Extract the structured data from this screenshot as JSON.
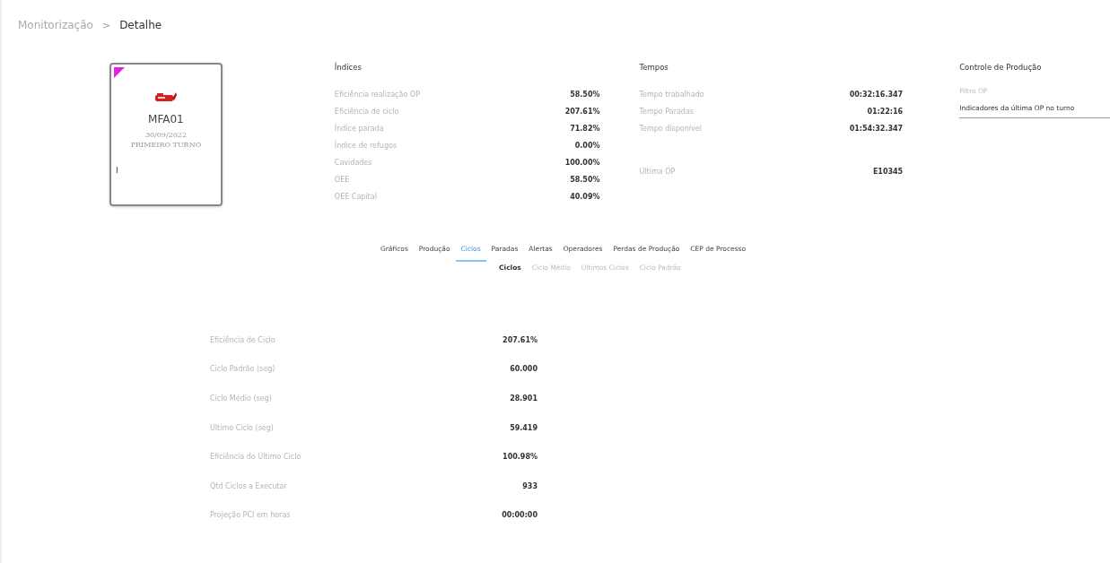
{
  "breadcrumb": [
    {
      "label": "Monitorização",
      "selected": false
    },
    {
      "label": "Detalhe",
      "selected": true
    }
  ],
  "breadcrumb_separator": ">",
  "machine_card": {
    "name": "MFA01",
    "date": "30/09/2022",
    "shift": "PRIMEIRO TURNO",
    "footer": "I"
  },
  "indices": {
    "title": "Índices",
    "rows": [
      {
        "label": "Eficiência realização OP",
        "value": "58.50%"
      },
      {
        "label": "Eficiência de ciclo",
        "value": "207.61%"
      },
      {
        "label": "Índice parada",
        "value": "71.82%"
      },
      {
        "label": "Índice de refugos",
        "value": "0.00%"
      },
      {
        "label": "Cavidades",
        "value": "100.00%"
      },
      {
        "label": "OEE",
        "value": "58.50%"
      },
      {
        "label": "OEE Capital",
        "value": "40.09%"
      }
    ]
  },
  "tempos": {
    "title": "Tempos",
    "rows": [
      {
        "label": "Tempo trabalhado",
        "value": "00:32:16.347"
      },
      {
        "label": "Tempo Paradas",
        "value": "01:22:16"
      },
      {
        "label": "Tempo disponível",
        "value": "01:54:32.347"
      }
    ],
    "last_op": {
      "label": "Última OP",
      "value": "E10345"
    }
  },
  "controle": {
    "title": "Controle de Produção",
    "filter": {
      "label": "Filtro OP",
      "value": "Indicadores da última OP no turno"
    }
  },
  "tabs": [
    {
      "label": "Gráficos",
      "selected": false
    },
    {
      "label": "Produção",
      "selected": false
    },
    {
      "label": "Ciclos",
      "selected": true
    },
    {
      "label": "Paradas",
      "selected": false
    },
    {
      "label": "Alertas",
      "selected": false
    },
    {
      "label": "Operadores",
      "selected": false
    },
    {
      "label": "Perdas de Produção",
      "selected": false
    },
    {
      "label": "CEP de Processo",
      "selected": false
    }
  ],
  "subtabs": [
    {
      "label": "Ciclos",
      "selected": true
    },
    {
      "label": "Ciclo Médio",
      "selected": false
    },
    {
      "label": "Últimos Ciclos",
      "selected": false
    },
    {
      "label": "Ciclo Padrão",
      "selected": false
    }
  ],
  "cycles": [
    {
      "label": "Eficiência de Ciclo",
      "value": "207.61%"
    },
    {
      "label": "Ciclo Padrão (seg)",
      "value": "60.000"
    },
    {
      "label": "Ciclo Médio (seg)",
      "value": "28.901"
    },
    {
      "label": "Último Ciclo (seg)",
      "value": "59.419"
    },
    {
      "label": "Eficiência do Último Ciclo",
      "value": "100.98%"
    },
    {
      "label": "Qtd Ciclos a Executar",
      "value": "933"
    },
    {
      "label": "Projeção PCI em horas",
      "value": "00:00:00"
    }
  ]
}
